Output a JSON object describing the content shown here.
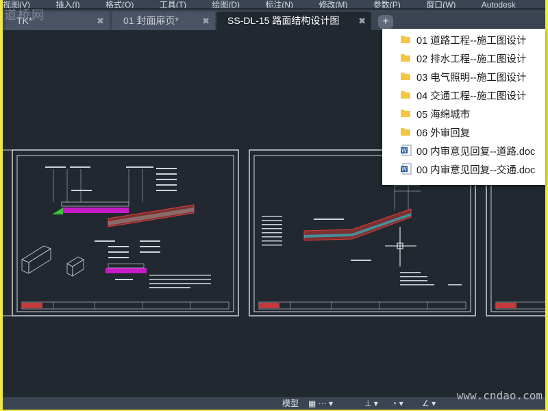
{
  "menubar": {
    "items": [
      "视图(V)",
      "插入(I)",
      "格式(O)",
      "工具(T)",
      "绘图(D)",
      "标注(N)",
      "修改(M)",
      "参数(P)",
      "窗口(W)",
      "Autodesk"
    ]
  },
  "watermarks": {
    "top_left": "道桥网",
    "bottom_right": "www.cndao.com"
  },
  "tabs": [
    {
      "label": "TK*"
    },
    {
      "label": "01 封面扉页*"
    },
    {
      "label": "SS-DL-15 路面结构设计图"
    }
  ],
  "file_menu": {
    "items": [
      {
        "label": "01 道路工程--施工图设计",
        "icon": "folder-icon"
      },
      {
        "label": "02 排水工程--施工图设计",
        "icon": "folder-icon"
      },
      {
        "label": "03 电气照明--施工图设计",
        "icon": "folder-icon"
      },
      {
        "label": "04 交通工程--施工图设计",
        "icon": "folder-icon"
      },
      {
        "label": "05 海绵城市",
        "icon": "folder-icon"
      },
      {
        "label": "06 外审回复",
        "icon": "folder-icon"
      },
      {
        "label": "00 内审意见回复--道路.doc",
        "icon": "word-doc-icon"
      },
      {
        "label": "00 内审意见回复--交通.doc",
        "icon": "word-doc-icon"
      }
    ]
  },
  "statusbar": {
    "model_label": "模型"
  },
  "colors": {
    "background": "#212830",
    "toolbar": "#3b4453",
    "frame": "#f2e93a",
    "folder": "#f3c745",
    "word": "#2b5ca8"
  }
}
